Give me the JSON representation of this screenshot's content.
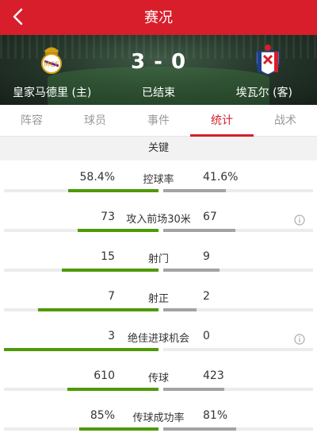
{
  "header": {
    "title": "赛况"
  },
  "match": {
    "home": {
      "name": "皇家马德里 (主)"
    },
    "away": {
      "name": "埃瓦尔 (客)"
    },
    "score": "3 - 0",
    "status": "已结束"
  },
  "tabs": [
    {
      "label": "阵容",
      "active": false
    },
    {
      "label": "球员",
      "active": false
    },
    {
      "label": "事件",
      "active": false
    },
    {
      "label": "统计",
      "active": true
    },
    {
      "label": "战术",
      "active": false
    }
  ],
  "section_title": "关键",
  "stats": [
    {
      "label": "控球率",
      "home": "58.4%",
      "away": "41.6%",
      "home_fill": 0.584,
      "away_fill": 0.416,
      "info": false
    },
    {
      "label": "攻入前场30米",
      "home": "73",
      "away": "67",
      "home_fill": 0.521,
      "away_fill": 0.479,
      "info": true
    },
    {
      "label": "射门",
      "home": "15",
      "away": "9",
      "home_fill": 0.625,
      "away_fill": 0.375,
      "info": false
    },
    {
      "label": "射正",
      "home": "7",
      "away": "2",
      "home_fill": 0.778,
      "away_fill": 0.222,
      "info": false
    },
    {
      "label": "绝佳进球机会",
      "home": "3",
      "away": "0",
      "home_fill": 1.0,
      "away_fill": 0.0,
      "info": true
    },
    {
      "label": "传球",
      "home": "610",
      "away": "423",
      "home_fill": 0.591,
      "away_fill": 0.409,
      "info": false
    },
    {
      "label": "传球成功率",
      "home": "85%",
      "away": "81%",
      "home_fill": 0.512,
      "away_fill": 0.488,
      "info": false
    }
  ],
  "colors": {
    "brand_red": "#d81e2a",
    "home_bar": "#4e9a06",
    "away_bar": "#a3a3a3",
    "section_bg": "#f2f2f2"
  },
  "icons": {
    "back": "chevron-left-icon",
    "info": "info-circle-icon",
    "home_crest": "real-madrid-crest-icon",
    "away_crest": "eibar-crest-icon"
  }
}
